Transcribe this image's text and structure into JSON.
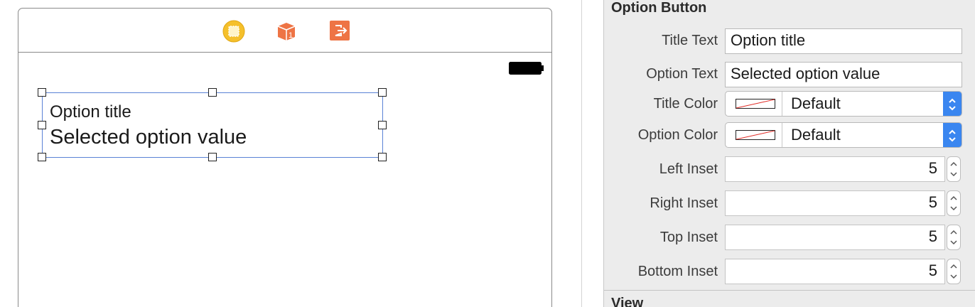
{
  "canvas": {
    "icons": [
      "view-controller-icon",
      "first-responder-icon",
      "exit-icon"
    ],
    "dock_badge": "1",
    "preview": {
      "title": "Option title",
      "value": "Selected option value"
    }
  },
  "inspector": {
    "section_title": "Option Button",
    "title_text": {
      "label": "Title Text",
      "value": "Option title"
    },
    "option_text": {
      "label": "Option Text",
      "value": "Selected option value"
    },
    "title_color": {
      "label": "Title Color",
      "value": "Default"
    },
    "option_color": {
      "label": "Option Color",
      "value": "Default"
    },
    "left_inset": {
      "label": "Left Inset",
      "value": "5"
    },
    "right_inset": {
      "label": "Right Inset",
      "value": "5"
    },
    "top_inset": {
      "label": "Top Inset",
      "value": "5"
    },
    "bottom_inset": {
      "label": "Bottom Inset",
      "value": "5"
    },
    "next_section_title": "View"
  },
  "colors": {
    "accent": "#3a86f0",
    "selection_border": "#5a82d6",
    "dock_yellow": "#f5c02b",
    "dock_orange": "#ee7445"
  }
}
